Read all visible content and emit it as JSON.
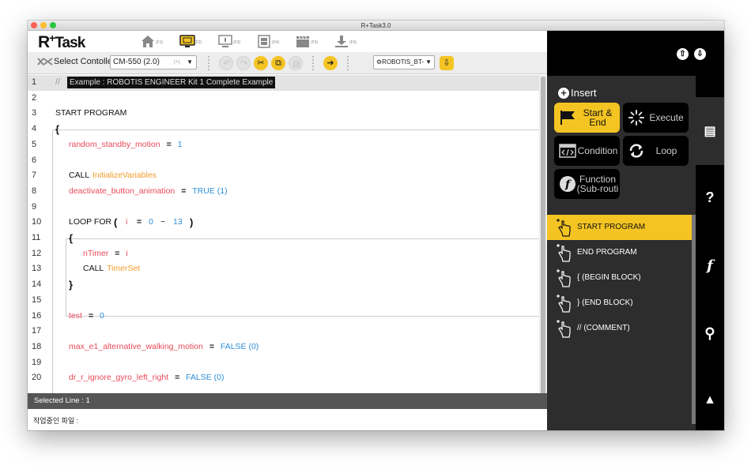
{
  "window": {
    "title": "R+Task3.0"
  },
  "logo": {
    "r": "R",
    "plus": "+",
    "task": "Task"
  },
  "nav": [
    {
      "icon": "home-icon",
      "key": "(F1)"
    },
    {
      "icon": "monitor-icon",
      "key": "(F2)"
    },
    {
      "icon": "presentation-icon",
      "key": "(F3)"
    },
    {
      "icon": "film-icon",
      "key": "(F4)"
    },
    {
      "icon": "clapperboard-icon",
      "key": "(F5)"
    },
    {
      "icon": "download-icon",
      "key": "(F6)"
    }
  ],
  "toolbar": {
    "select_controller_label": "Select Contoller",
    "controller_value": "CM-550 (2.0)",
    "controller_ext": "(+)",
    "device_value": "ROBOTIS_BT-"
  },
  "editor": {
    "selected_line": "1",
    "lines": [
      {
        "n": "1",
        "comment_prefix": "//",
        "comment": "Example : ROBOTIS ENGINEER Kit 1 Complete Example"
      },
      {
        "n": "2"
      },
      {
        "n": "3",
        "text": "START PROGRAM"
      },
      {
        "n": "4",
        "text": "{"
      },
      {
        "n": "5",
        "var": "random_standby_motion",
        "op": "=",
        "val": "1"
      },
      {
        "n": "6"
      },
      {
        "n": "7",
        "kw": "CALL",
        "fn": "InitializeVariables"
      },
      {
        "n": "8",
        "var": "deactivate_button_animation",
        "op": "=",
        "val": "TRUE (1)"
      },
      {
        "n": "9"
      },
      {
        "n": "10",
        "kw": "LOOP FOR",
        "paren_open": "(",
        "var": "i",
        "op": "=",
        "from": "0",
        "tilde": "~",
        "to": "13",
        "paren_close": ")"
      },
      {
        "n": "11",
        "text": "{"
      },
      {
        "n": "12",
        "var": "nTimer",
        "op": "=",
        "val": "i"
      },
      {
        "n": "13",
        "kw": "CALL",
        "fn": "TimerSet"
      },
      {
        "n": "14",
        "text": "}"
      },
      {
        "n": "15"
      },
      {
        "n": "16",
        "var": "test",
        "op": "=",
        "val": "0"
      },
      {
        "n": "17"
      },
      {
        "n": "18",
        "var": "max_e1_alternative_walking_motion",
        "op": "=",
        "val": "FALSE (0)"
      },
      {
        "n": "19"
      },
      {
        "n": "20",
        "var": "dr_r_ignore_gyro_left_right",
        "op": "=",
        "val": "FALSE (0)"
      }
    ]
  },
  "status": {
    "text": "Selected Line : 1"
  },
  "bottom": {
    "text": "작업중인 파일 :"
  },
  "panel": {
    "insert_label": "Insert",
    "categories": [
      {
        "label": "Start & End",
        "icon": "flag-icon",
        "active": true
      },
      {
        "label": "Execute",
        "icon": "spinner-icon",
        "active": false
      },
      {
        "label": "Condition",
        "icon": "code-window-icon",
        "active": false
      },
      {
        "label": "Loop",
        "icon": "loop-icon",
        "active": false
      },
      {
        "label": "Function (Sub-routi",
        "icon": "function-icon",
        "active": false
      }
    ],
    "items": [
      {
        "label": "START PROGRAM",
        "active": true
      },
      {
        "label": "END PROGRAM",
        "active": false
      },
      {
        "label": "{  (BEGIN BLOCK)",
        "active": false
      },
      {
        "label": "}  (END BLOCK)",
        "active": false
      },
      {
        "label": "//  (COMMENT)",
        "active": false
      }
    ],
    "side_icons": [
      "message-icon",
      "help-icon",
      "function-f-icon",
      "location-pin-icon",
      "warning-icon"
    ]
  },
  "colors": {
    "accent": "#f4c423",
    "variable": "#e84a5a",
    "number": "#2f8fd8",
    "function": "#f49c2a",
    "panel_bg": "#2d2d2d",
    "panel_dark": "#000000"
  }
}
